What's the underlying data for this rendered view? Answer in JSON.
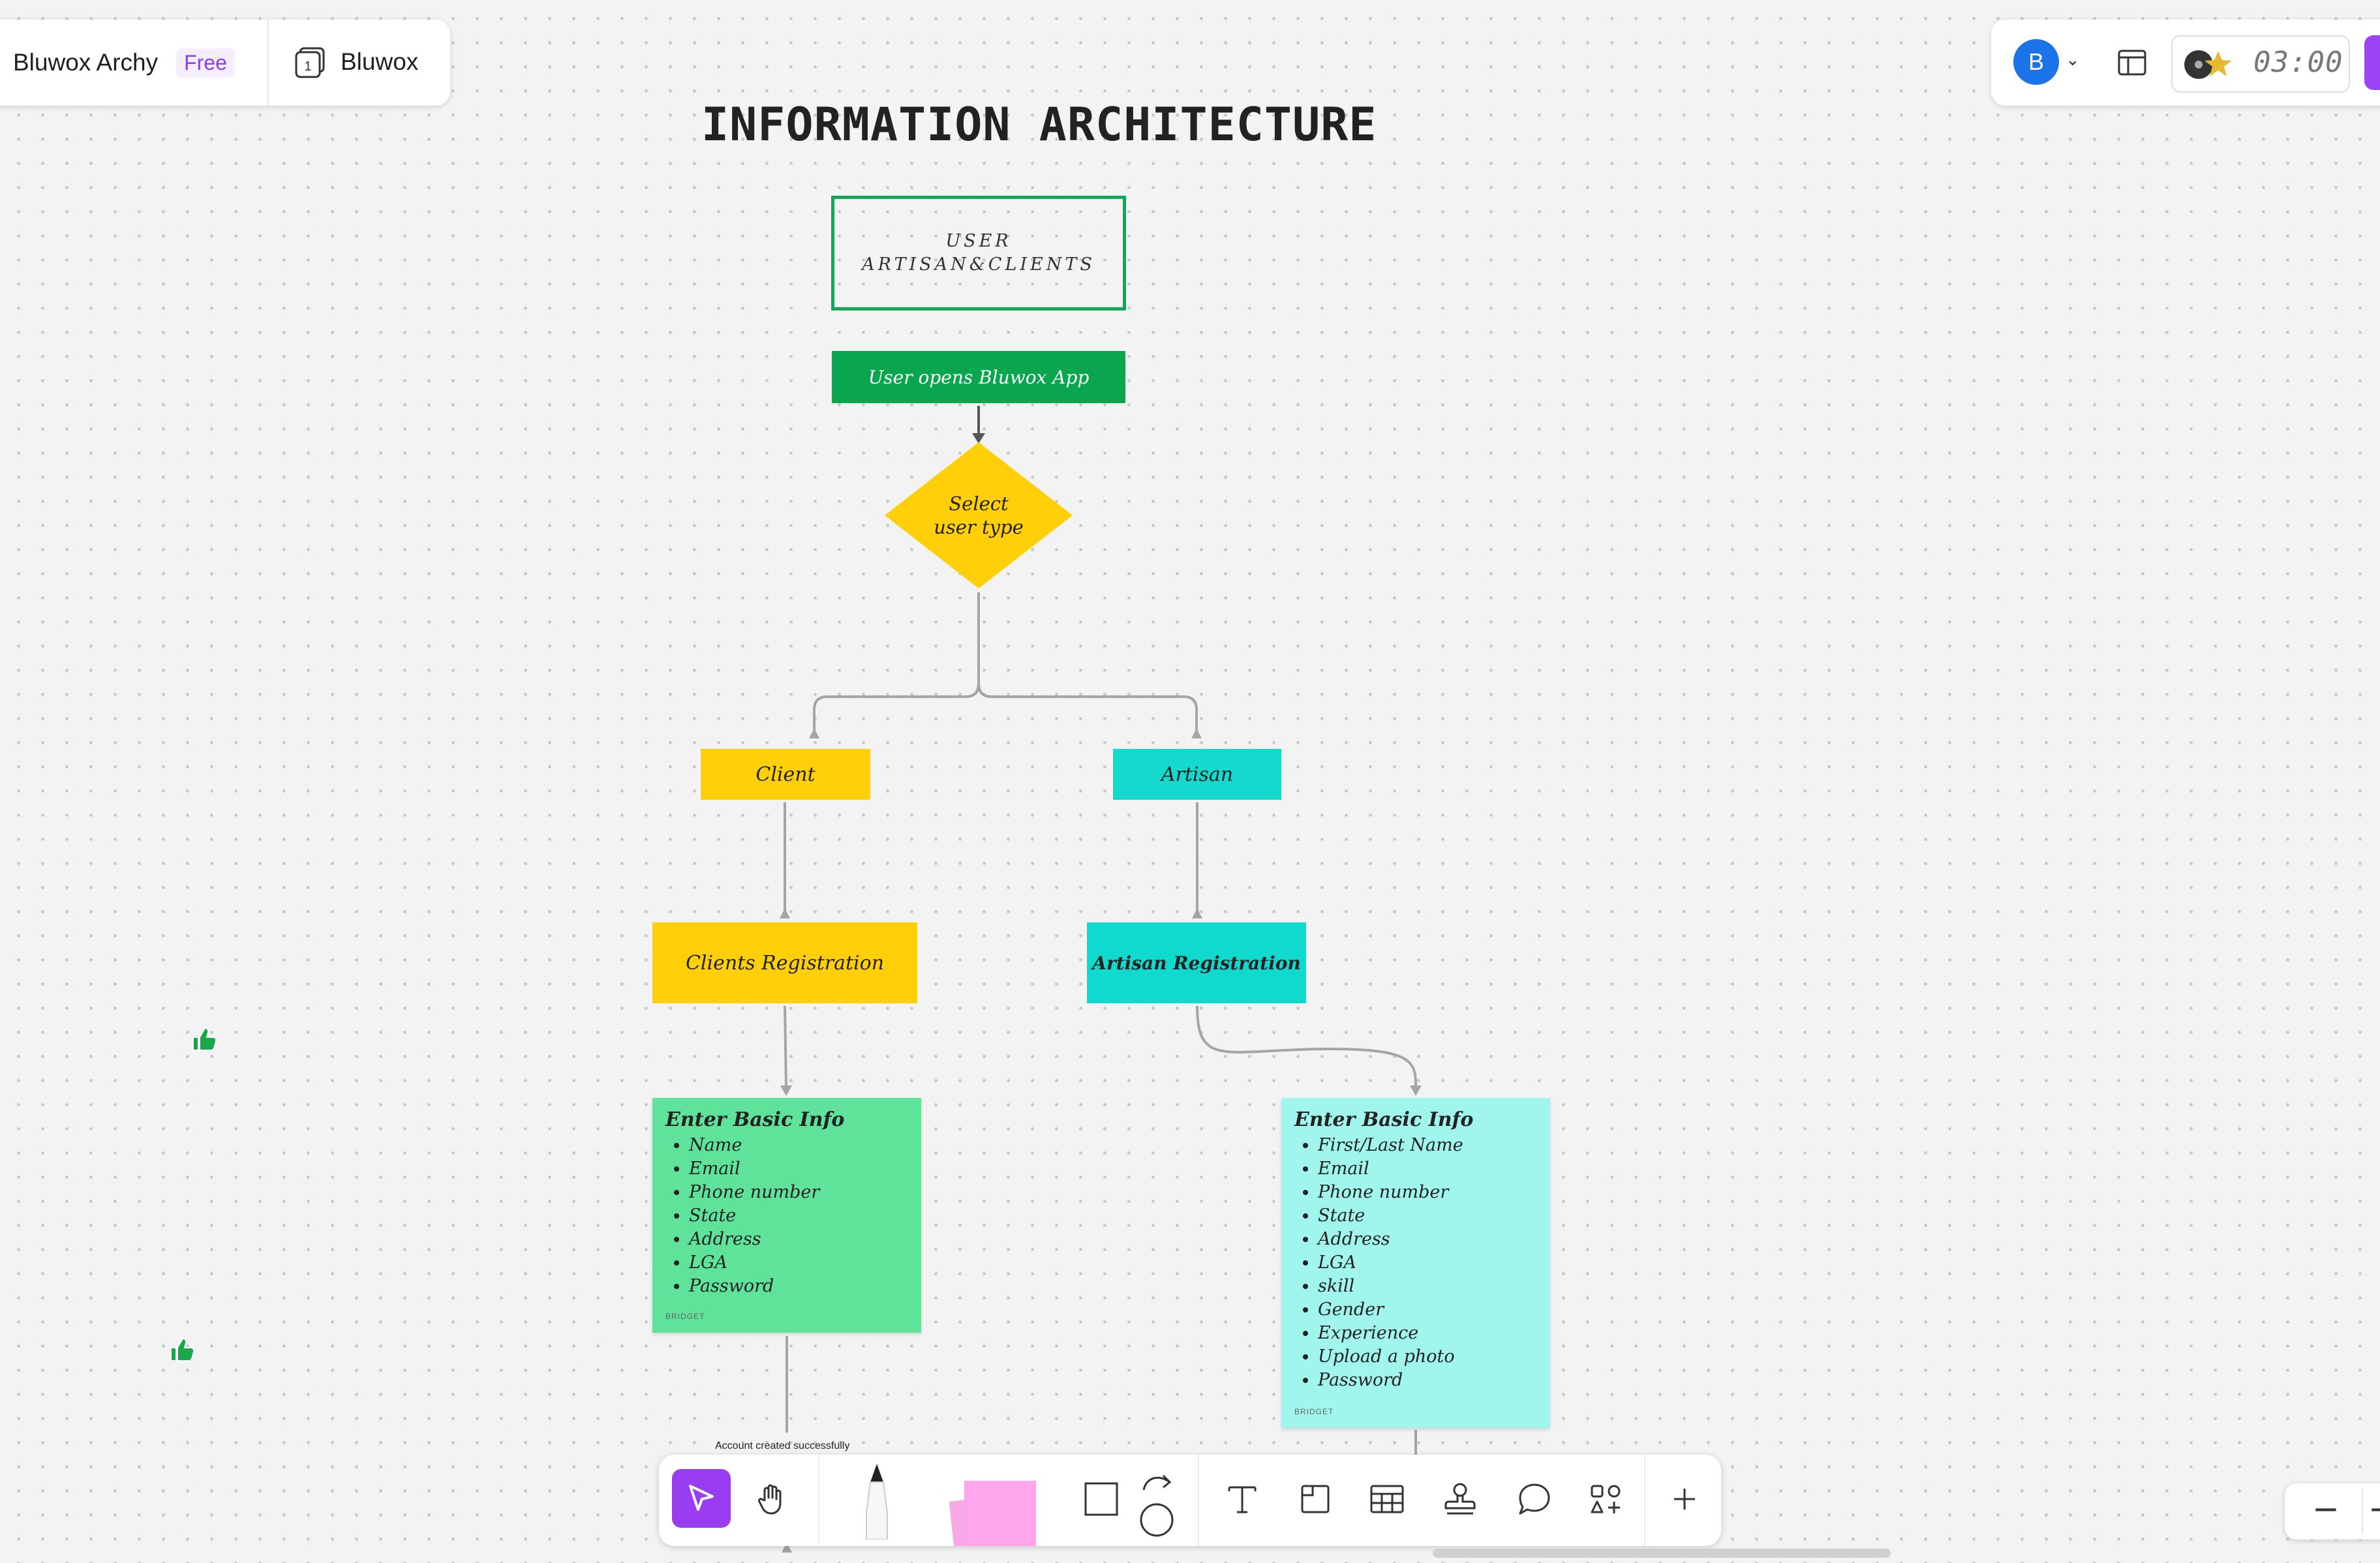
{
  "header": {
    "board_name": "Bluwox Archy",
    "plan_badge": "Free",
    "frames_count": "1",
    "frames_label": "Bluwox"
  },
  "topbar_right": {
    "avatar_initial": "B",
    "timer": "03:00"
  },
  "diagram": {
    "title": "INFORMATION ARCHITECTURE",
    "user_node_line1": "USER",
    "user_node_line2": "ARTISAN&CLIENTS",
    "open_app": "User opens Bluwox App",
    "decision_line1": "Select",
    "decision_line2": "user type",
    "client": "Client",
    "artisan": "Artisan",
    "clients_registration": "Clients Registration",
    "artisan_registration": "Artisan Registration",
    "client_info": {
      "title": "Enter Basic Info",
      "items": [
        "Name",
        "Email",
        "Phone number",
        "State",
        "Address",
        "LGA",
        "Password"
      ],
      "author": "BRIDGET"
    },
    "artisan_info": {
      "title": "Enter Basic Info",
      "items": [
        "First/Last Name",
        "Email",
        "Phone number",
        "State",
        "Address",
        "LGA",
        "skill",
        "Gender",
        "Experience",
        "Upload a photo",
        "Password"
      ],
      "author": "BRIDGET"
    },
    "edge_label": "Account created successfully"
  },
  "toolbar": {
    "tools": [
      "select-tool",
      "hand-tool",
      "pen-tool",
      "sticky-note-tool",
      "shape-tool",
      "connector-tool",
      "text-tool",
      "frame-tool",
      "table-tool",
      "stamp-tool",
      "comment-tool",
      "more-apps-tool",
      "add-tool"
    ]
  },
  "zoom": {
    "minus": "−",
    "plus": "+"
  },
  "colors": {
    "canvas": "#f3f3f3",
    "accent_purple": "#9a3cf2",
    "green_node": "#0aa64f",
    "yellow_node": "#ffd00a",
    "teal_node": "#14d9cc",
    "sticky_green": "#5fe29a",
    "sticky_teal": "#a0f5ec"
  }
}
